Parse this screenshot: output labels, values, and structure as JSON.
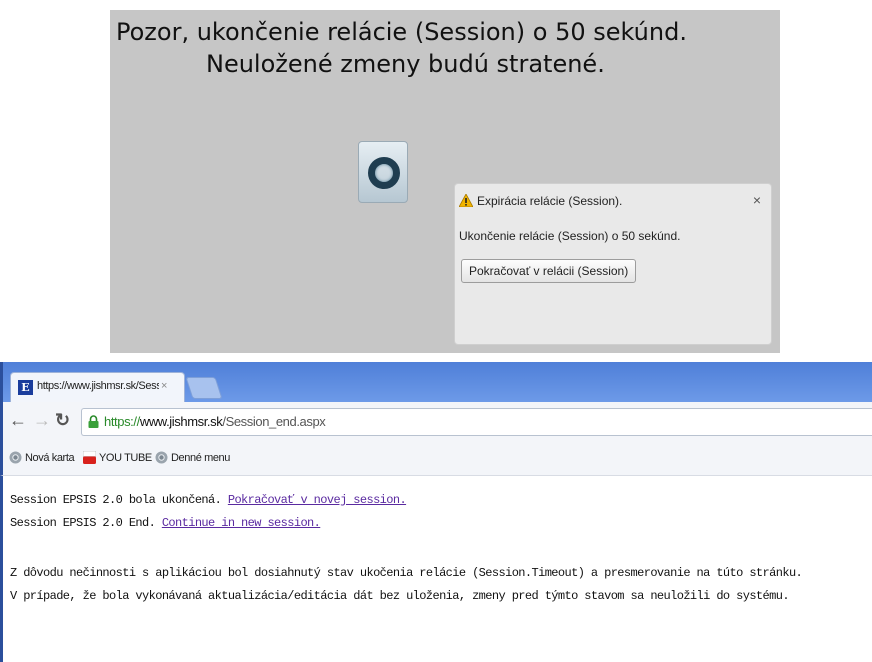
{
  "warning_panel": {
    "line1": "Pozor, ukončenie relácie (Session) o 50 sekúnd.",
    "line2": "Neuložené zmeny budú stratené."
  },
  "dialog": {
    "title": "Expirácia relácie (Session).",
    "close": "×",
    "message": "Ukončenie relácie (Session) o  50 sekúnd.",
    "button": "Pokračovať v relácii (Session)"
  },
  "browser": {
    "tab_title": "https://www.jishmsr.sk/Sessio",
    "tab_close": "×",
    "favicon": "E",
    "url_https": "https://",
    "url_host": "www.jishmsr.sk",
    "url_path": "/Session_end.aspx",
    "bookmarks": [
      {
        "label": "Nová karta",
        "icon": "chrome-icon"
      },
      {
        "label": "YOU TUBE",
        "icon": "youtube-icon"
      },
      {
        "label": "Denné menu",
        "icon": "chrome-icon"
      }
    ]
  },
  "content": {
    "sk_text": "Session EPSIS 2.0 bola ukončená. ",
    "sk_link": "Pokračovať v novej session.",
    "en_text": "Session EPSIS 2.0 End. ",
    "en_link": "Continue in new session.",
    "para1": "Z dôvodu nečinnosti s aplikáciou bol dosiahnutý stav ukočenia relácie (Session.Timeout) a presmerovanie na túto stránku.",
    "para2": "V prípade, že bola vykonávaná aktualizácia/editácia dát bez uloženia, zmeny pred týmto stavom sa neuložili do systému."
  }
}
